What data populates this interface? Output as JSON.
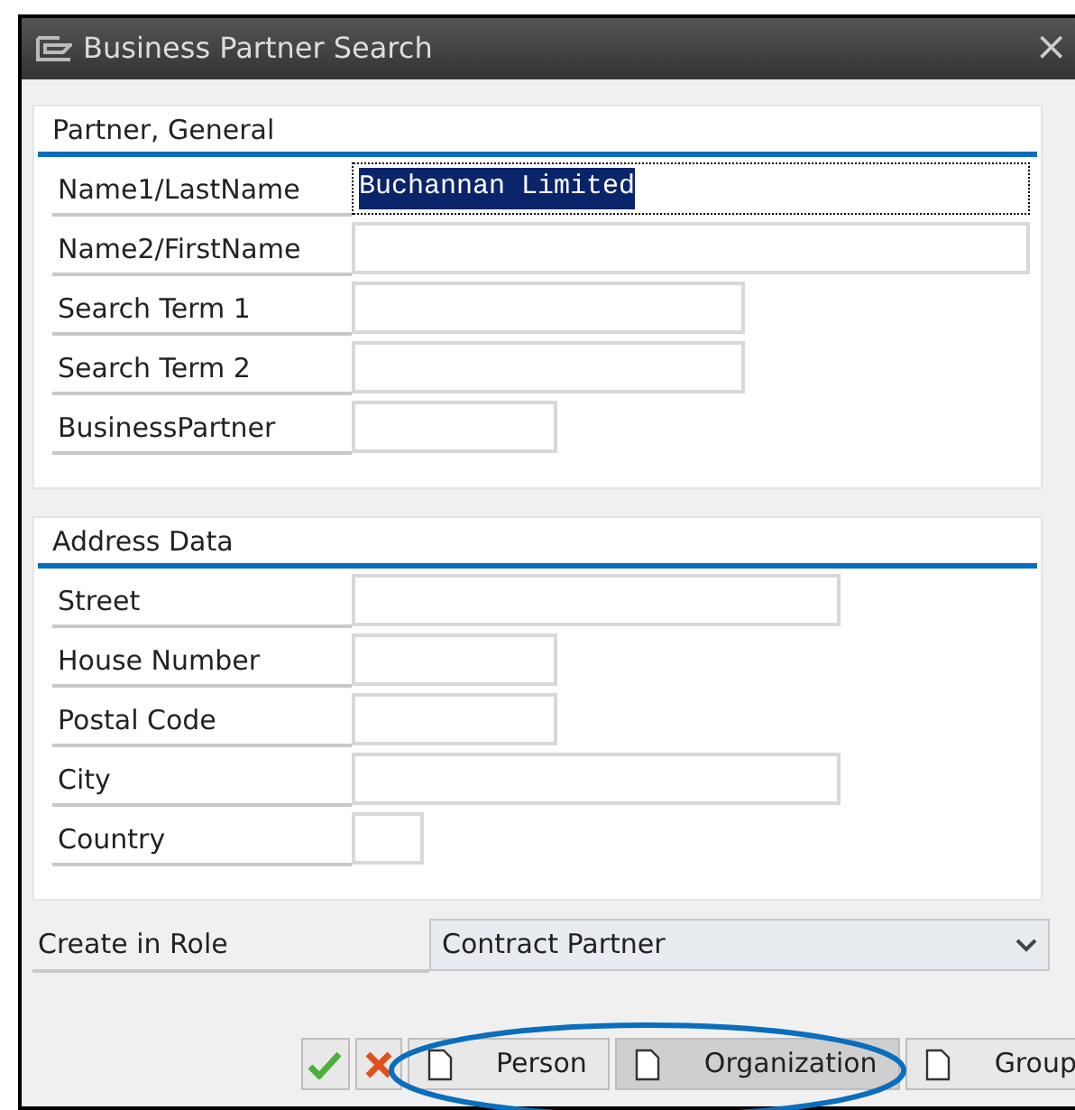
{
  "window": {
    "title": "Business Partner Search",
    "close": "×"
  },
  "sections": [
    {
      "title": "Partner, General",
      "fields": [
        {
          "label": "Name1/LastName",
          "value": "Buchannan Limited",
          "kind": "wide",
          "focused": true
        },
        {
          "label": "Name2/FirstName",
          "kind": "wide",
          "focused": false
        },
        {
          "label": "Search Term 1",
          "kind": "medium",
          "focused": false
        },
        {
          "label": "Search Term 2",
          "kind": "medium",
          "focused": false
        },
        {
          "label": "BusinessPartner",
          "kind": "short",
          "focused": false
        }
      ]
    },
    {
      "title": "Address Data",
      "fields": [
        {
          "label": "Street",
          "kind": "long",
          "focused": false
        },
        {
          "label": "House Number",
          "kind": "short",
          "focused": false
        },
        {
          "label": "Postal Code",
          "kind": "short",
          "focused": false
        },
        {
          "label": "City",
          "kind": "long",
          "focused": false
        },
        {
          "label": "Country",
          "kind": "tiny",
          "focused": false
        }
      ]
    }
  ],
  "role": {
    "label": "Create in Role",
    "value": "Contract Partner"
  },
  "buttons": [
    {
      "kind": "confirm"
    },
    {
      "kind": "cancel"
    },
    {
      "kind": "doc",
      "label": "Person",
      "selected": false
    },
    {
      "kind": "doc",
      "label": "Organization",
      "selected": true
    },
    {
      "kind": "doc",
      "label": "Group",
      "selected": false
    }
  ]
}
